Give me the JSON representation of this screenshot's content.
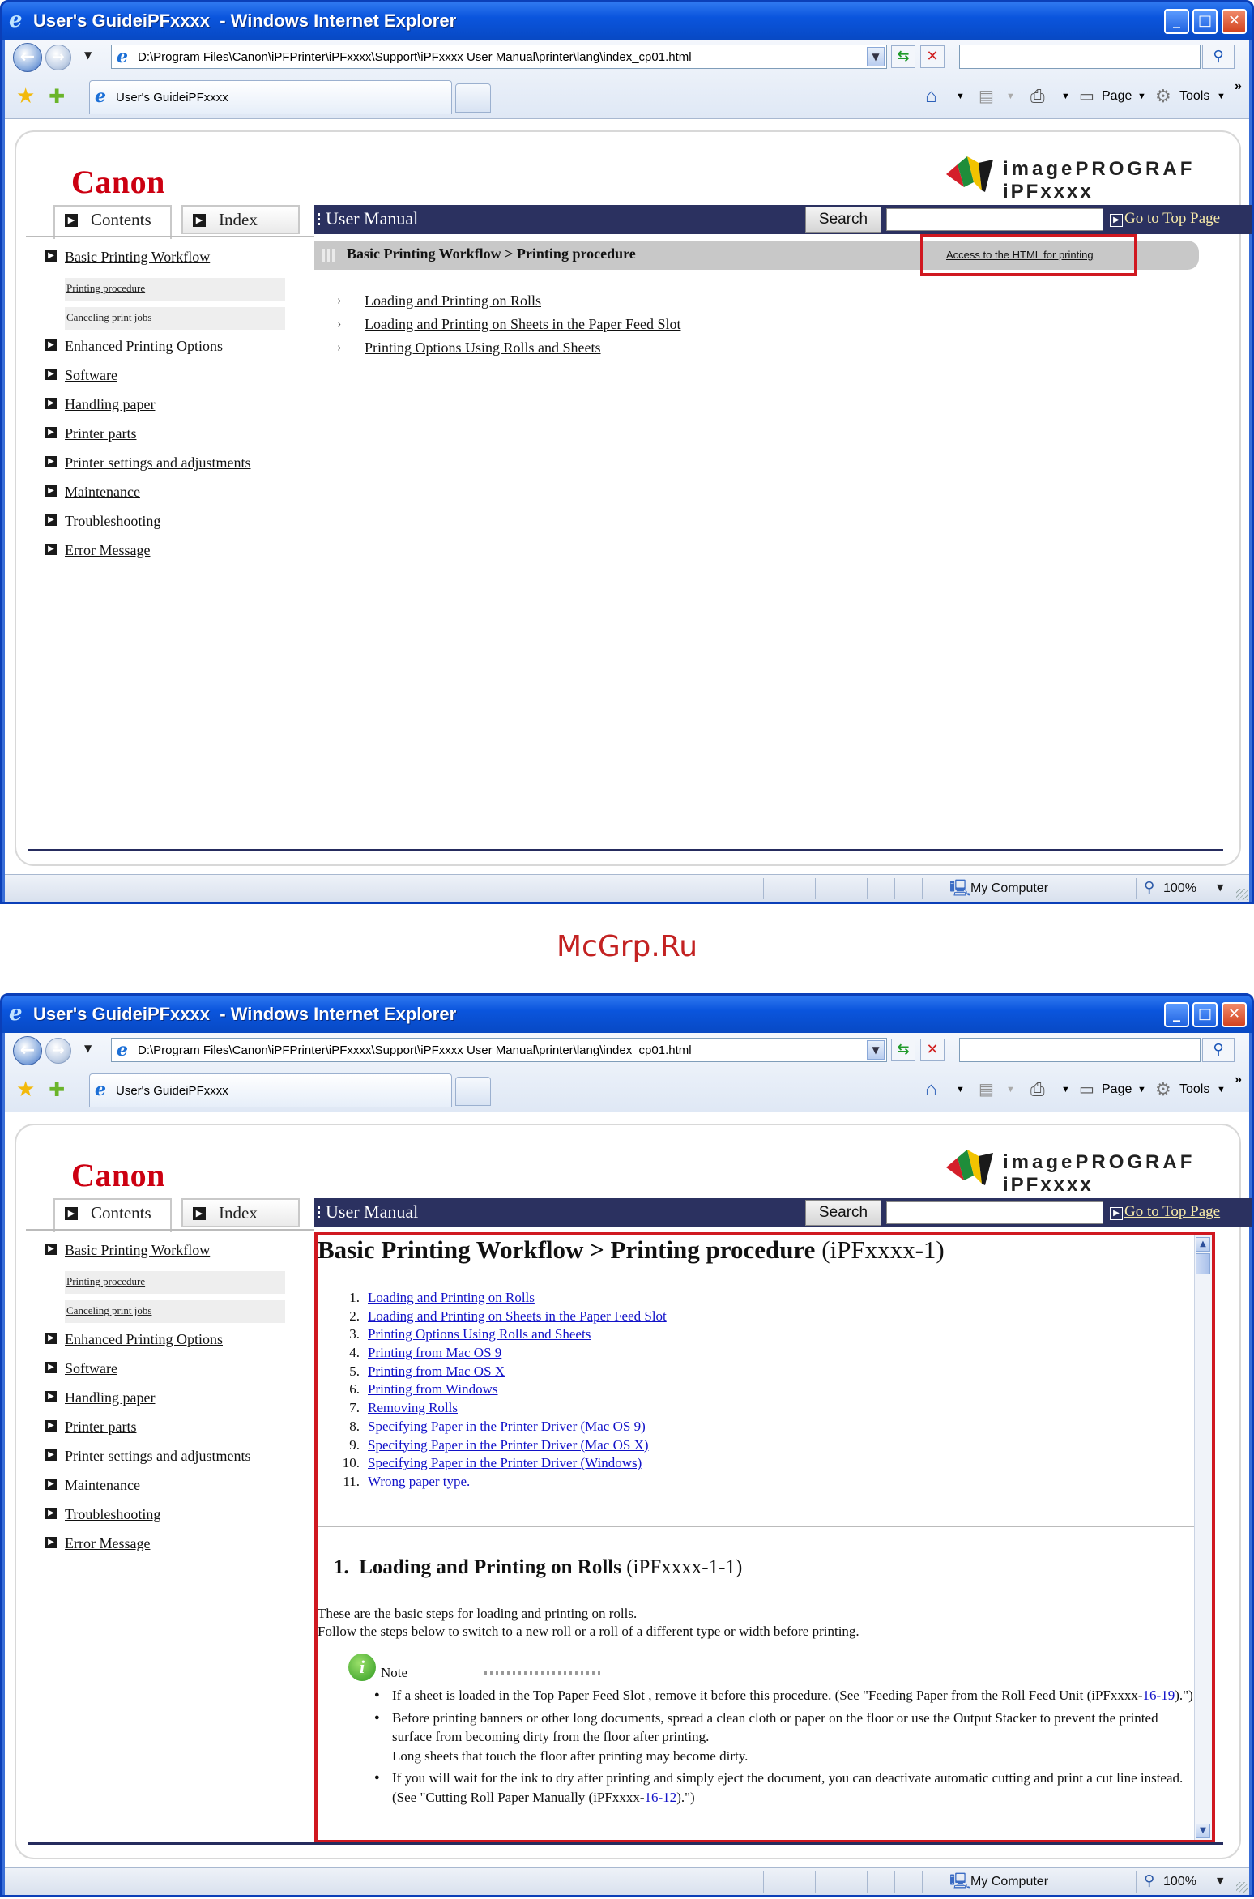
{
  "browser": {
    "title": "User's GuideiPFxxxx  - Windows Internet Explorer",
    "address": "D:\\Program Files\\Canon\\iPFPrinter\\iPFxxxx\\Support\\iPFxxxx User Manual\\printer\\lang\\index_cp01.html",
    "tab_title": "User's GuideiPFxxxx",
    "page_menu": "Page",
    "tools_menu": "Tools",
    "status_zone": "My Computer",
    "zoom": "100%"
  },
  "site": {
    "logo": "Canon",
    "brand_line1": "imagePROGRAF",
    "brand_line2": "iPFxxxx",
    "tab_contents": "Contents",
    "tab_index": "Index",
    "manual_title": "User Manual",
    "search_button": "Search",
    "top_link": "Go to Top Page"
  },
  "sidebar": {
    "items": [
      {
        "label": "Basic Printing Workflow",
        "subs": [
          "Printing procedure",
          "Canceling print jobs"
        ]
      },
      {
        "label": "Enhanced Printing Options"
      },
      {
        "label": "Software"
      },
      {
        "label": "Handling paper"
      },
      {
        "label": "Printer parts"
      },
      {
        "label": "Printer settings and adjustments"
      },
      {
        "label": "Maintenance"
      },
      {
        "label": "Troubleshooting"
      },
      {
        "label": "Error Message"
      }
    ]
  },
  "shot1": {
    "breadcrumb": "Basic Printing Workflow > Printing procedure",
    "html_link": "Access to the HTML for printing",
    "links": [
      "Loading and Printing on Rolls",
      "Loading and Printing on Sheets in the Paper Feed Slot",
      "Printing Options Using Rolls and Sheets"
    ]
  },
  "watermark": "McGrp.Ru",
  "shot2": {
    "heading": "Basic Printing Workflow > Printing procedure",
    "heading_code": "(iPFxxxx-1)",
    "toc": [
      {
        "num": "1.",
        "label": "Loading and Printing on Rolls"
      },
      {
        "num": "2.",
        "label": "Loading and Printing on Sheets in the Paper Feed Slot"
      },
      {
        "num": "3.",
        "label": "Printing Options Using Rolls and Sheets"
      },
      {
        "num": "4.",
        "label": "Printing from Mac OS 9"
      },
      {
        "num": "5.",
        "label": "Printing from Mac OS X"
      },
      {
        "num": "6.",
        "label": "Printing from Windows"
      },
      {
        "num": "7.",
        "label": "Removing Rolls"
      },
      {
        "num": "8.",
        "label": "Specifying Paper in the Printer Driver (Mac OS 9)"
      },
      {
        "num": "9.",
        "label": "Specifying Paper in the Printer Driver (Mac OS X)"
      },
      {
        "num": "10.",
        "label": "Specifying Paper in the Printer Driver (Windows)"
      },
      {
        "num": "11.",
        "label": "Wrong paper type."
      }
    ],
    "section_num": "1.",
    "section_title": "Loading and Printing on Rolls",
    "section_code": "(iPFxxxx-1-1)",
    "intro1": "These are the basic steps for loading and printing on rolls.",
    "intro2": "Follow the steps below to switch to a new roll or a roll of a different type or width before printing.",
    "note_label": "Note",
    "bullet1_pre": "If a sheet is loaded in the Top Paper Feed Slot , remove it before this procedure. (See \"Feeding Paper from the Roll Feed Unit (iPFxxxx-",
    "bullet1_link": "16-19",
    "bullet1_post": ").\")",
    "bullet2_a": "Before printing banners or other long documents, spread a clean cloth or paper on the floor or use the Output Stacker to prevent the printed surface from becoming dirty from the floor after printing.",
    "bullet2_b": "Long sheets that touch the floor after printing may become dirty.",
    "bullet3_pre": "If you will wait for the ink to dry after printing and simply eject the document, you can deactivate automatic cutting and print a cut line instead.  (See \"Cutting Roll Paper Manually (iPFxxxx-",
    "bullet3_link": "16-12",
    "bullet3_post": ").\")"
  }
}
